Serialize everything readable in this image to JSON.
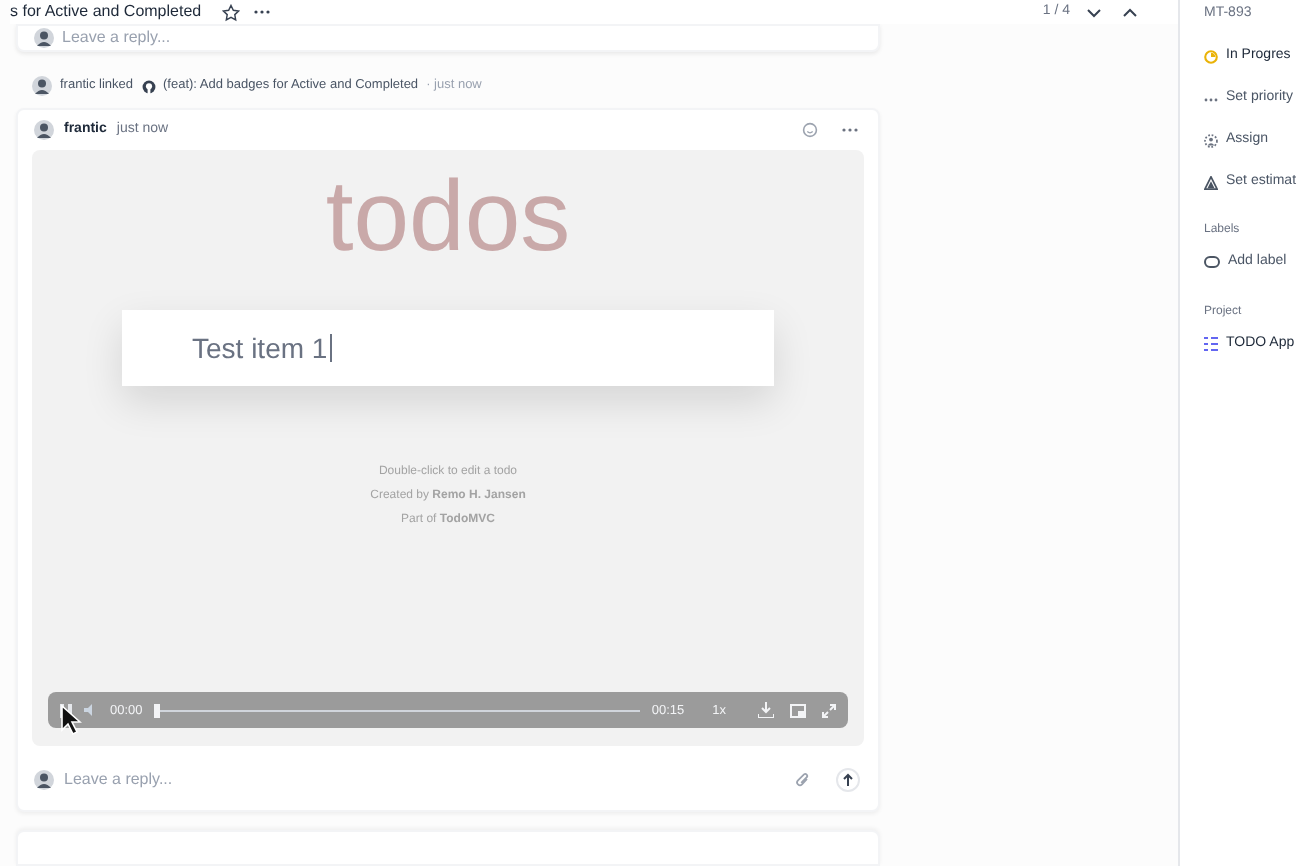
{
  "header": {
    "title": "s for Active and Completed",
    "pager": "1 / 4"
  },
  "top_card": {
    "reply_placeholder": "Leave a reply..."
  },
  "activity": {
    "actor": "frantic linked",
    "link": "(feat): Add badges for Active and Completed",
    "time": "· just now"
  },
  "comment": {
    "author": "frantic",
    "time": "just now",
    "video": {
      "app_title": "todos",
      "input_value": "Test item 1",
      "footer": [
        "Double-click to edit a todo",
        "Created by **Remo H. Jansen**",
        "Part of **TodoMVC**"
      ],
      "controls": {
        "current": "00:00",
        "duration": "00:15",
        "speed": "1x",
        "level": 0
      }
    },
    "reply_placeholder": "Leave a reply..."
  },
  "sidebar": {
    "issue_id": "MT-893",
    "items": [
      {
        "kind": "status",
        "label": "In Progres"
      },
      {
        "kind": "priority",
        "label": "Set priority"
      },
      {
        "kind": "assignee",
        "label": "Assign"
      },
      {
        "kind": "estimate",
        "label": "Set estimat"
      }
    ],
    "labels": {
      "heading": "Labels",
      "action": "Add label"
    },
    "project": {
      "heading": "Project",
      "name": "TODO App"
    }
  }
}
